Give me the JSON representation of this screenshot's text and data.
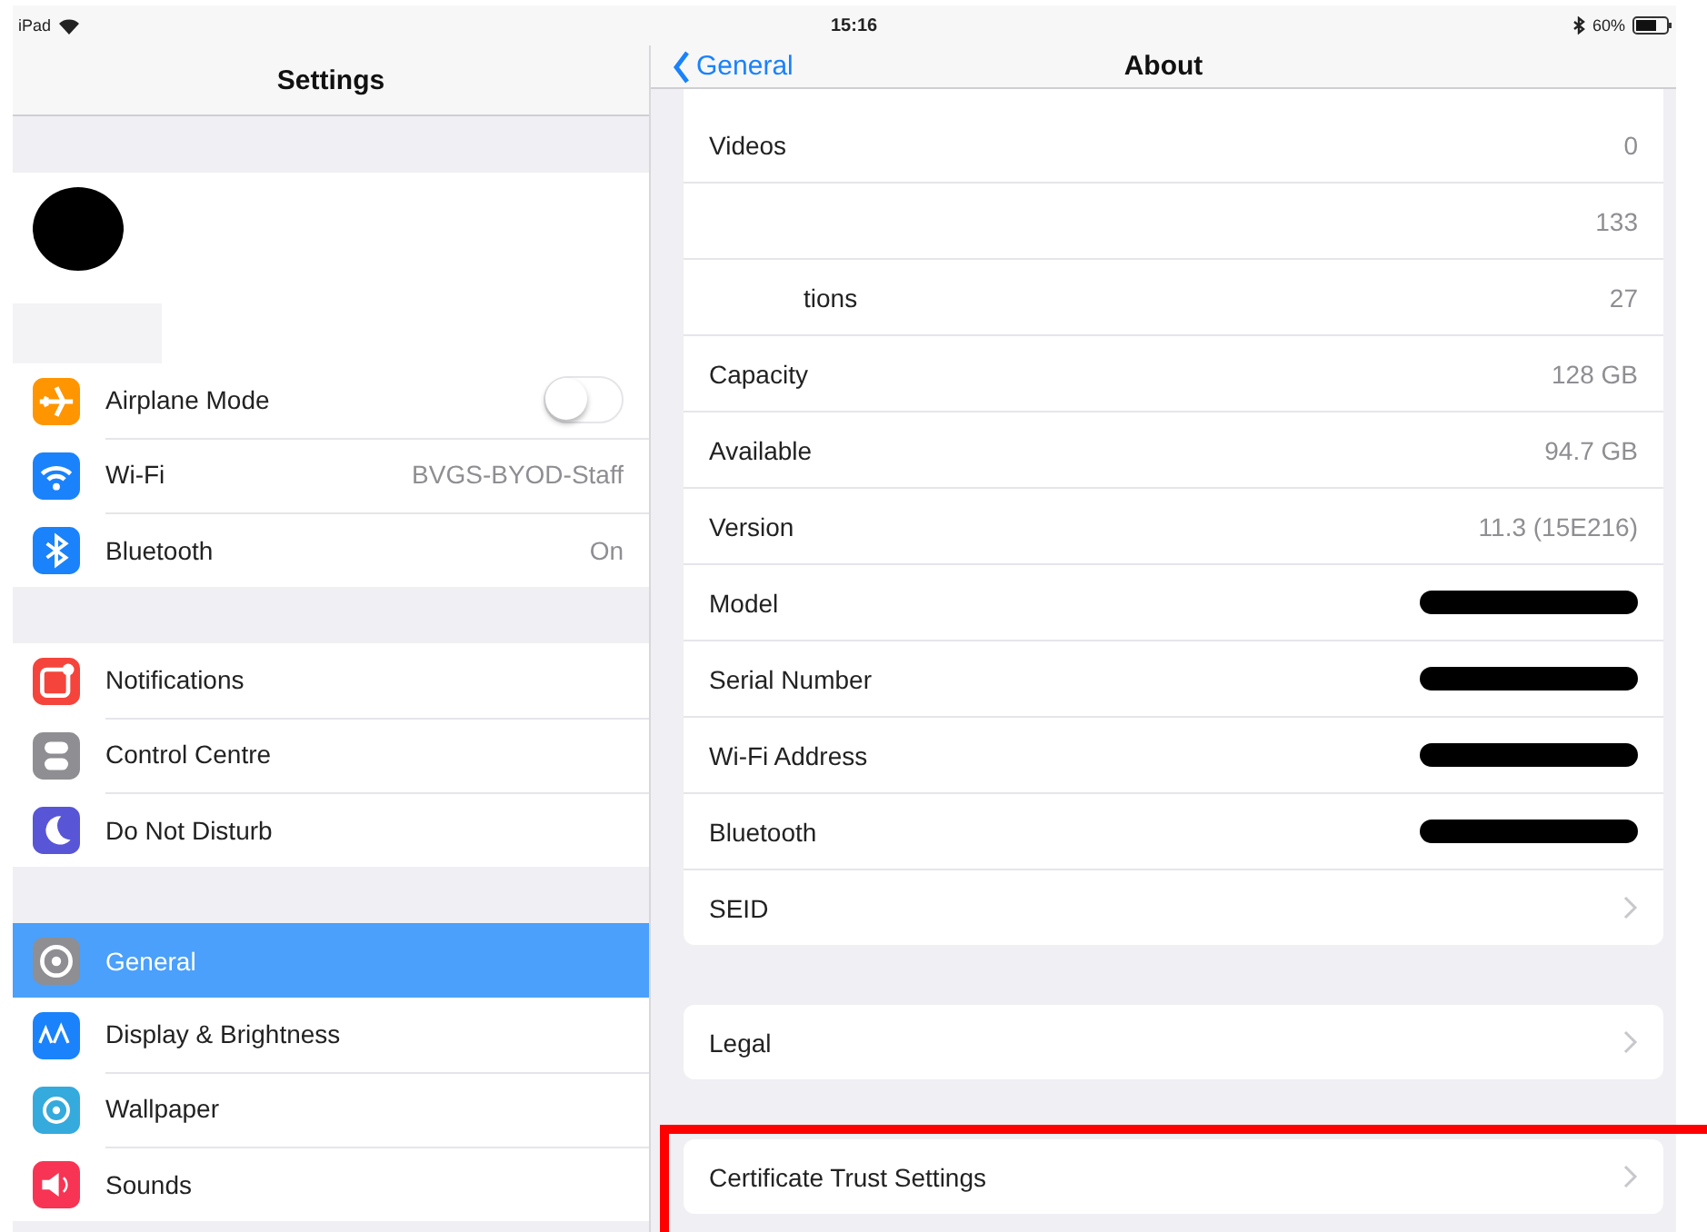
{
  "status_bar": {
    "device": "iPad",
    "time": "15:16",
    "battery": "60%"
  },
  "sidebar": {
    "title": "Settings",
    "sections": [
      [
        {
          "kind": "toggle",
          "label": "Airplane Mode",
          "on": false,
          "color": "#ff9500",
          "selected": false
        },
        {
          "kind": "value",
          "label": "Wi-Fi",
          "value": "BVGS-BYOD-Staff",
          "color": "#1a82fb",
          "selected": false
        },
        {
          "kind": "value",
          "label": "Bluetooth",
          "value": "On",
          "color": "#1a82fb",
          "selected": false
        }
      ],
      [
        {
          "kind": "plain",
          "label": "Notifications",
          "color": "#f5443b",
          "selected": false
        },
        {
          "kind": "plain",
          "label": "Control Centre",
          "color": "#8e8e93",
          "selected": false
        },
        {
          "kind": "plain",
          "label": "Do Not Disturb",
          "color": "#5856d6",
          "selected": false
        }
      ],
      [
        {
          "kind": "plain",
          "label": "General",
          "color": "#8e8e93",
          "selected": true
        },
        {
          "kind": "plain",
          "label": "Display & Brightness",
          "color": "#1a82fb",
          "selected": false
        },
        {
          "kind": "plain",
          "label": "Wallpaper",
          "color": "#35aadc",
          "selected": false
        },
        {
          "kind": "plain",
          "label": "Sounds",
          "color": "#f73454",
          "selected": false
        }
      ]
    ]
  },
  "detail": {
    "back": "General",
    "title": "About",
    "groups": [
      [
        {
          "kind": "value",
          "label": "Videos",
          "value": "0"
        },
        {
          "kind": "value",
          "value": "133"
        },
        {
          "kind": "value",
          "label": "tions",
          "clipped": true,
          "value": "27"
        },
        {
          "kind": "value",
          "label": "Capacity",
          "value": "128 GB"
        },
        {
          "kind": "value",
          "label": "Available",
          "value": "94.7 GB"
        },
        {
          "kind": "value",
          "label": "Version",
          "value": "11.3 (15E216)"
        },
        {
          "kind": "redacted",
          "label": "Model"
        },
        {
          "kind": "redacted",
          "label": "Serial Number"
        },
        {
          "kind": "redacted",
          "label": "Wi-Fi Address"
        },
        {
          "kind": "redacted",
          "label": "Bluetooth"
        },
        {
          "kind": "chevron",
          "label": "SEID"
        }
      ],
      [
        {
          "kind": "chevron",
          "label": "Legal"
        }
      ],
      [
        {
          "kind": "chevron",
          "label": "Certificate Trust Settings",
          "highlighted": true
        }
      ]
    ]
  }
}
